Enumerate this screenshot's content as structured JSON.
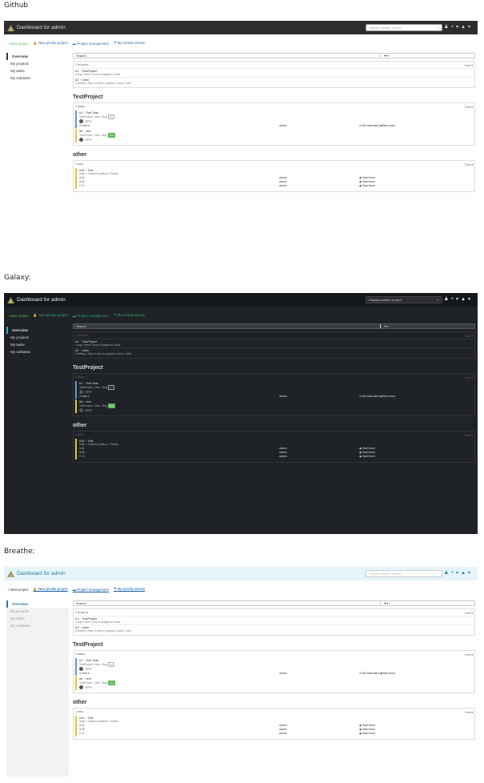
{
  "labels": {
    "github": "Github",
    "galaxy": "Galaxy:",
    "breathe": "Breathe:"
  },
  "app": {
    "title": "Dashboard for admin",
    "project_select": "Display another project"
  },
  "actions": {
    "new_project": "+ New project",
    "new_private": "New private project",
    "project_mgmt": "Project management",
    "activity": "My activity stream"
  },
  "sidebar": [
    "Overview",
    "My projects",
    "My tasks",
    "My subtasks"
  ],
  "search": {
    "placeholder": "Search"
  },
  "projects": {
    "count": "2 projects",
    "sort": "Sort",
    "items": [
      {
        "title": "#1 ~ TestProject",
        "sub": "4 bug 4 fixes 0 new in progress 0 done"
      },
      {
        "title": "#2 ~ other",
        "sub": "0 testing 1 fixes 0 new in progress 0 done 1 test"
      }
    ]
  },
  "testproject": {
    "title": "TestProject",
    "count": "2 tasks",
    "sort": "Sort",
    "task1": {
      "title": "#1 ~ Test Task",
      "path": "TestProject > test > Bug",
      "tag": "cnt",
      "user": "admin",
      "sub": "test 2",
      "sub_user": "admin",
      "estimate": "3.00h estimated",
      "timer": "Start timer"
    },
    "task2": {
      "title": "#8 ~ test",
      "path": "TestProject > test > Bug",
      "tag": "test",
      "user": "admin"
    }
  },
  "other": {
    "title": "other",
    "count": "1 task",
    "sort": "Sort",
    "task": {
      "title": "#16 ~ Test",
      "path": "other > Default workflow > Ready",
      "subs": [
        {
          "name": "A",
          "user": "admin",
          "timer": "Start timer"
        },
        {
          "name": "B",
          "user": "admin",
          "timer": "Start timer"
        },
        {
          "name": "C",
          "user": "admin",
          "timer": "Start timer"
        }
      ]
    }
  }
}
